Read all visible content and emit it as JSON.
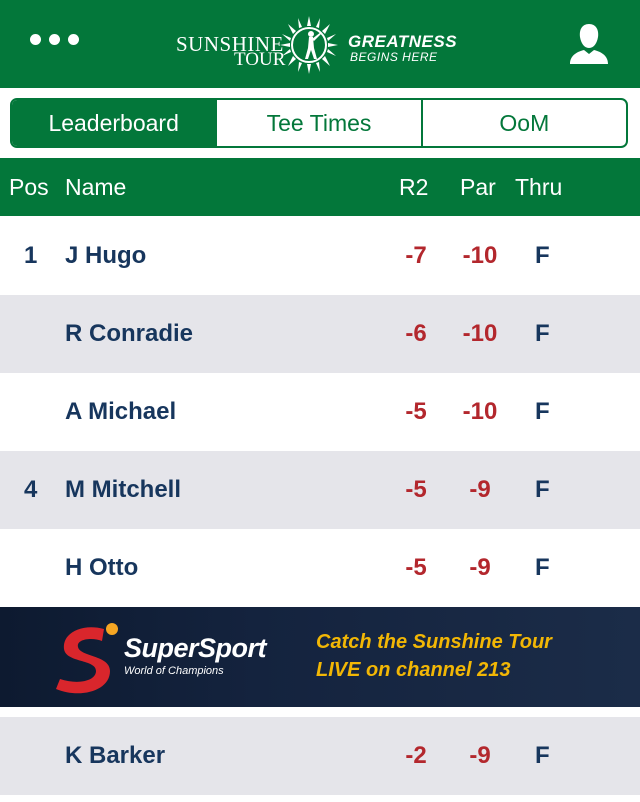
{
  "header": {
    "logo_left_top": "SUNSHINE",
    "logo_left_bottom": "TOUR",
    "logo_right_top": "GREATNESS",
    "logo_right_bottom": "BEGINS HERE",
    "menu_icon": "more-dots-icon",
    "user_icon": "user-profile-icon"
  },
  "tabs": [
    {
      "label": "Leaderboard",
      "active": true
    },
    {
      "label": "Tee Times",
      "active": false
    },
    {
      "label": "OoM",
      "active": false
    }
  ],
  "columns": {
    "pos": "Pos",
    "name": "Name",
    "r2": "R2",
    "par": "Par",
    "thru": "Thru"
  },
  "rows": [
    {
      "pos": "1",
      "name": "J Hugo",
      "r2": "-7",
      "par": "-10",
      "thru": "F"
    },
    {
      "pos": "",
      "name": "R Conradie",
      "r2": "-6",
      "par": "-10",
      "thru": "F"
    },
    {
      "pos": "",
      "name": "A Michael",
      "r2": "-5",
      "par": "-10",
      "thru": "F"
    },
    {
      "pos": "4",
      "name": "M Mitchell",
      "r2": "-5",
      "par": "-9",
      "thru": "F"
    },
    {
      "pos": "",
      "name": "H Otto",
      "r2": "-5",
      "par": "-9",
      "thru": "F"
    },
    {
      "pos": "",
      "name": "K Barker",
      "r2": "-2",
      "par": "-9",
      "thru": "F"
    }
  ],
  "banner": {
    "brand": "SuperSport",
    "tagline": "World of Champions",
    "promo_line1": "Catch the Sunshine Tour",
    "promo_line2": "LIVE on channel 213"
  },
  "colors": {
    "brand_green": "#03773a",
    "score_red": "#b3272d",
    "name_navy": "#17365d",
    "row_alt": "#e5e5ea",
    "promo_yellow": "#f2b705"
  }
}
